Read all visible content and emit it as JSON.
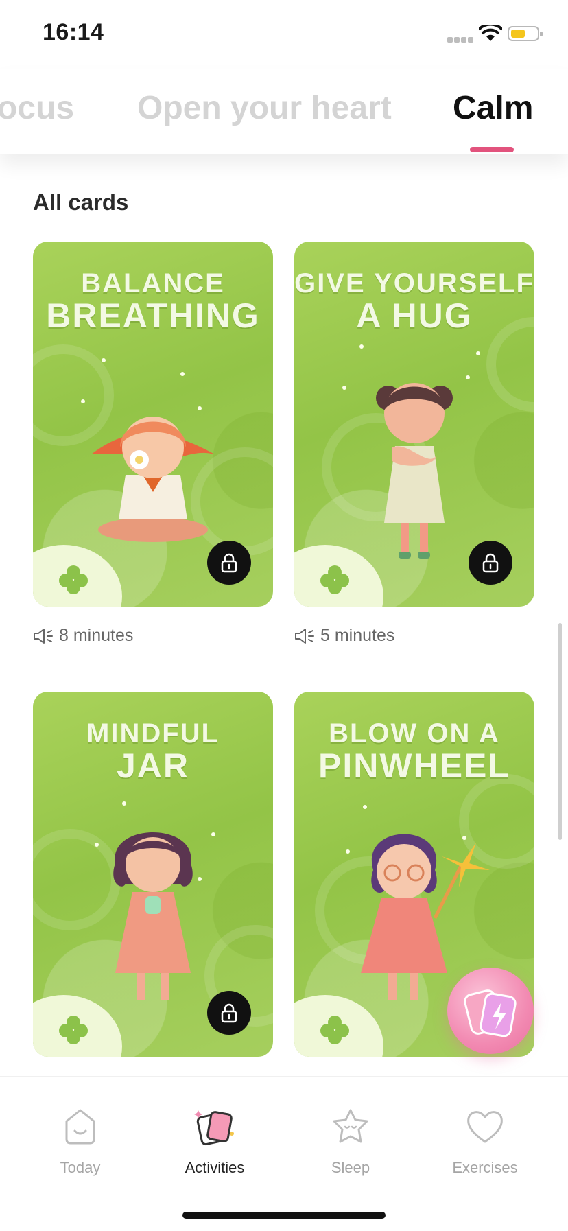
{
  "status_bar": {
    "time": "16:14"
  },
  "tabs": [
    {
      "label": "ocus",
      "active": false
    },
    {
      "label": "Open your heart",
      "active": false
    },
    {
      "label": "Calm",
      "active": true
    }
  ],
  "section_title": "All cards",
  "cards": [
    {
      "title_line1": "BALANCE",
      "title_line2": "BREATHING",
      "duration": "8 minutes",
      "locked": true
    },
    {
      "title_line1": "GIVE YOURSELF",
      "title_line2": "A HUG",
      "duration": "5 minutes",
      "locked": true
    },
    {
      "title_line1": "MINDFUL",
      "title_line2": "JAR",
      "duration": "",
      "locked": true
    },
    {
      "title_line1": "BLOW ON A",
      "title_line2": "PINWHEEL",
      "duration": "",
      "locked": false
    }
  ],
  "bottom_nav": [
    {
      "label": "Today",
      "icon": "today-face-icon",
      "active": false
    },
    {
      "label": "Activities",
      "icon": "activities-cards-icon",
      "active": true
    },
    {
      "label": "Sleep",
      "icon": "sleep-star-icon",
      "active": false
    },
    {
      "label": "Exercises",
      "icon": "exercises-heart-icon",
      "active": false
    }
  ],
  "colors": {
    "accent": "#e2537d",
    "card_green": "#9ac94c",
    "lock": "#111111"
  }
}
